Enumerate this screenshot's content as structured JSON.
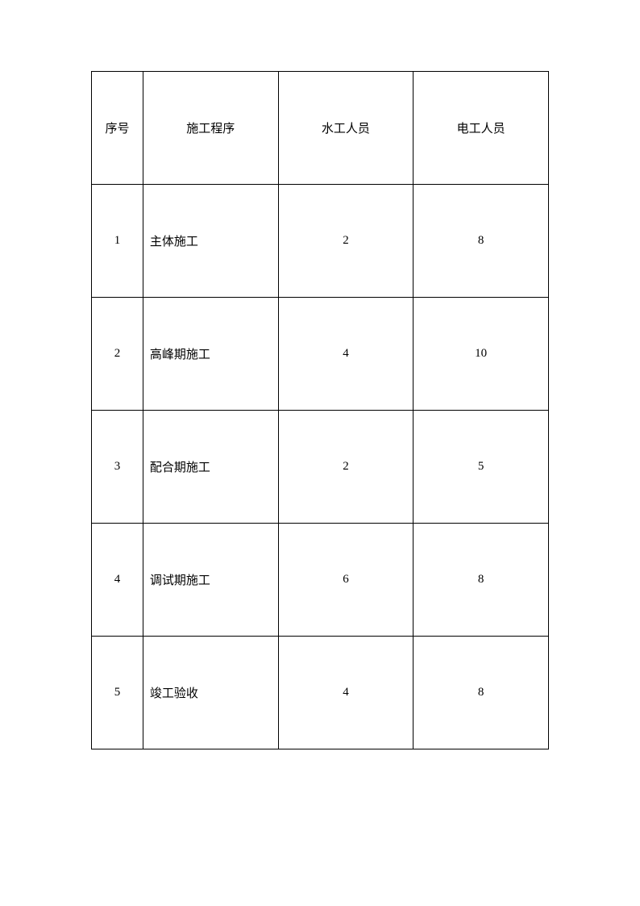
{
  "table": {
    "headers": {
      "seq": "序号",
      "proc": "施工程序",
      "water": "水工人员",
      "elec": "电工人员"
    },
    "rows": [
      {
        "seq": "1",
        "proc": "主体施工",
        "water": "2",
        "elec": "8"
      },
      {
        "seq": "2",
        "proc": "高峰期施工",
        "water": "4",
        "elec": "10"
      },
      {
        "seq": "3",
        "proc": "配合期施工",
        "water": "2",
        "elec": "5"
      },
      {
        "seq": "4",
        "proc": "调试期施工",
        "water": "6",
        "elec": "8"
      },
      {
        "seq": "5",
        "proc": "竣工验收",
        "water": "4",
        "elec": "8"
      }
    ]
  }
}
